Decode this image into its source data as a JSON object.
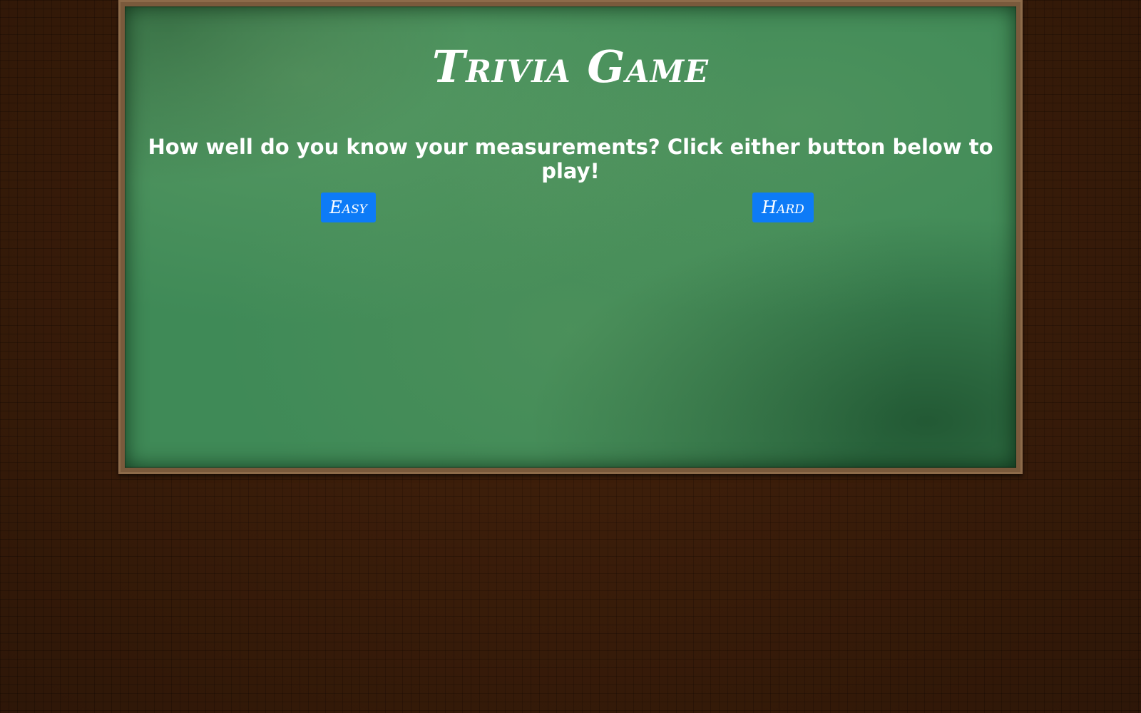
{
  "game": {
    "title": "Trivia Game",
    "subtitle": "How well do you know your measurements? Click either button below to play!",
    "buttons": {
      "easy_label": "Easy",
      "hard_label": "Hard"
    }
  },
  "colors": {
    "board": "#3f8a57",
    "frame": "#7a5a3c",
    "wall": "#3d1e0a",
    "button": "#0d7bf7",
    "text": "#ffffff"
  }
}
